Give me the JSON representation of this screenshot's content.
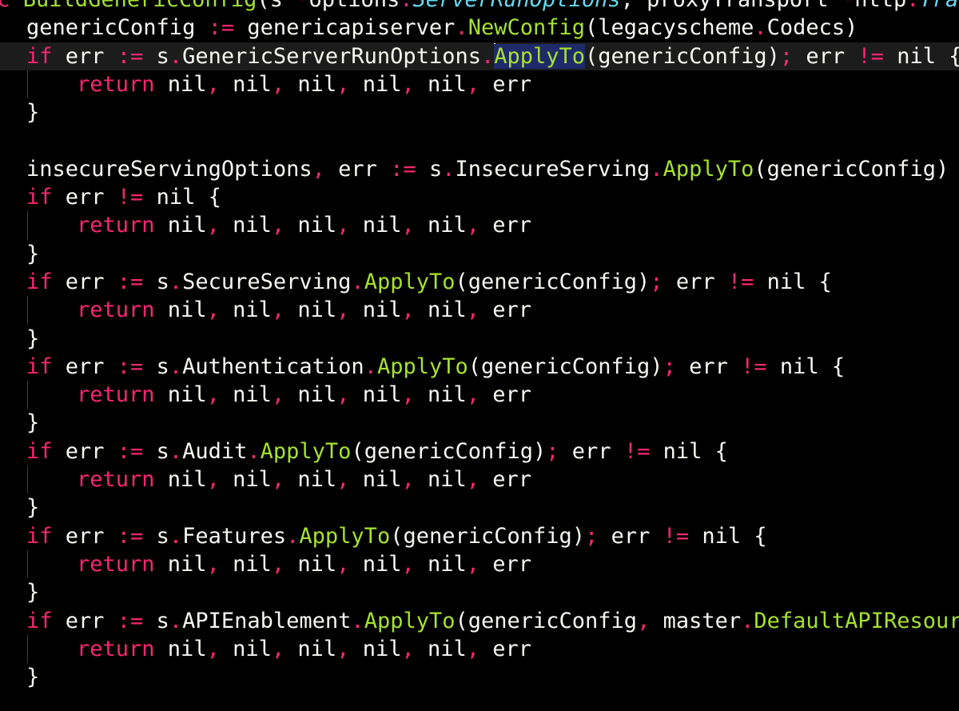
{
  "editor": {
    "language": "go",
    "theme_colors": {
      "background": "#000000",
      "text": "#f8f8f2",
      "keyword": "#f92672",
      "function": "#a6e22e",
      "type": "#66d9ef",
      "selection": "#1f2a6b",
      "current_line": "#1c1c1c",
      "indent_guide": "#3a3a3a"
    },
    "cursor": {
      "line": 2,
      "before_token": "ApplyTo"
    },
    "lines": [
      {
        "indent": 0,
        "guide": false,
        "current": false,
        "tokens": [
          {
            "t": "nc ",
            "c": "kw"
          },
          {
            "t": "BuildGenericConfig",
            "c": "fn"
          },
          {
            "t": "(s ",
            "c": "pl"
          },
          {
            "t": "*",
            "c": "op"
          },
          {
            "t": "options",
            "c": "pl"
          },
          {
            "t": ".",
            "c": "op"
          },
          {
            "t": "ServerRunOptions",
            "c": "ty"
          },
          {
            "t": ", proxyTransport ",
            "c": "pl"
          },
          {
            "t": "*",
            "c": "op"
          },
          {
            "t": "http",
            "c": "pl"
          },
          {
            "t": ".",
            "c": "op"
          },
          {
            "t": "Tran",
            "c": "ty"
          }
        ]
      },
      {
        "indent": 1,
        "guide": false,
        "current": false,
        "tokens": [
          {
            "t": "genericConfig ",
            "c": "pl"
          },
          {
            "t": ":=",
            "c": "op"
          },
          {
            "t": " genericapiserver",
            "c": "pl"
          },
          {
            "t": ".",
            "c": "op"
          },
          {
            "t": "NewConfig",
            "c": "fn"
          },
          {
            "t": "(legacyscheme",
            "c": "pl"
          },
          {
            "t": ".",
            "c": "op"
          },
          {
            "t": "Codecs)",
            "c": "pl"
          }
        ]
      },
      {
        "indent": 1,
        "guide": false,
        "current": true,
        "tokens": [
          {
            "t": "if",
            "c": "kw"
          },
          {
            "t": " err ",
            "c": "pl"
          },
          {
            "t": ":=",
            "c": "op"
          },
          {
            "t": " s",
            "c": "pl"
          },
          {
            "t": ".",
            "c": "op"
          },
          {
            "t": "GenericServerRunOptions",
            "c": "pl"
          },
          {
            "t": ".",
            "c": "op"
          },
          {
            "t": "ApplyTo",
            "c": "sel"
          },
          {
            "t": "(genericConfig)",
            "c": "pl"
          },
          {
            "t": ";",
            "c": "op"
          },
          {
            "t": " err ",
            "c": "pl"
          },
          {
            "t": "!=",
            "c": "op"
          },
          {
            "t": " nil {",
            "c": "pl"
          }
        ]
      },
      {
        "indent": 2,
        "guide": true,
        "current": false,
        "tokens": [
          {
            "t": "return",
            "c": "kw"
          },
          {
            "t": " nil",
            "c": "pl"
          },
          {
            "t": ",",
            "c": "op"
          },
          {
            "t": " nil",
            "c": "pl"
          },
          {
            "t": ",",
            "c": "op"
          },
          {
            "t": " nil",
            "c": "pl"
          },
          {
            "t": ",",
            "c": "op"
          },
          {
            "t": " nil",
            "c": "pl"
          },
          {
            "t": ",",
            "c": "op"
          },
          {
            "t": " nil",
            "c": "pl"
          },
          {
            "t": ",",
            "c": "op"
          },
          {
            "t": " err",
            "c": "pl"
          }
        ]
      },
      {
        "indent": 1,
        "guide": false,
        "current": false,
        "tokens": [
          {
            "t": "}",
            "c": "pl"
          }
        ]
      },
      {
        "indent": 1,
        "guide": false,
        "current": false,
        "tokens": []
      },
      {
        "indent": 1,
        "guide": false,
        "current": false,
        "tokens": [
          {
            "t": "insecureServingOptions",
            "c": "pl"
          },
          {
            "t": ",",
            "c": "op"
          },
          {
            "t": " err ",
            "c": "pl"
          },
          {
            "t": ":=",
            "c": "op"
          },
          {
            "t": " s",
            "c": "pl"
          },
          {
            "t": ".",
            "c": "op"
          },
          {
            "t": "InsecureServing",
            "c": "pl"
          },
          {
            "t": ".",
            "c": "op"
          },
          {
            "t": "ApplyTo",
            "c": "fn"
          },
          {
            "t": "(genericConfig)",
            "c": "pl"
          }
        ]
      },
      {
        "indent": 1,
        "guide": false,
        "current": false,
        "tokens": [
          {
            "t": "if",
            "c": "kw"
          },
          {
            "t": " err ",
            "c": "pl"
          },
          {
            "t": "!=",
            "c": "op"
          },
          {
            "t": " nil {",
            "c": "pl"
          }
        ]
      },
      {
        "indent": 2,
        "guide": true,
        "current": false,
        "tokens": [
          {
            "t": "return",
            "c": "kw"
          },
          {
            "t": " nil",
            "c": "pl"
          },
          {
            "t": ",",
            "c": "op"
          },
          {
            "t": " nil",
            "c": "pl"
          },
          {
            "t": ",",
            "c": "op"
          },
          {
            "t": " nil",
            "c": "pl"
          },
          {
            "t": ",",
            "c": "op"
          },
          {
            "t": " nil",
            "c": "pl"
          },
          {
            "t": ",",
            "c": "op"
          },
          {
            "t": " nil",
            "c": "pl"
          },
          {
            "t": ",",
            "c": "op"
          },
          {
            "t": " err",
            "c": "pl"
          }
        ]
      },
      {
        "indent": 1,
        "guide": false,
        "current": false,
        "tokens": [
          {
            "t": "}",
            "c": "pl"
          }
        ]
      },
      {
        "indent": 1,
        "guide": false,
        "current": false,
        "tokens": [
          {
            "t": "if",
            "c": "kw"
          },
          {
            "t": " err ",
            "c": "pl"
          },
          {
            "t": ":=",
            "c": "op"
          },
          {
            "t": " s",
            "c": "pl"
          },
          {
            "t": ".",
            "c": "op"
          },
          {
            "t": "SecureServing",
            "c": "pl"
          },
          {
            "t": ".",
            "c": "op"
          },
          {
            "t": "ApplyTo",
            "c": "fn"
          },
          {
            "t": "(genericConfig)",
            "c": "pl"
          },
          {
            "t": ";",
            "c": "op"
          },
          {
            "t": " err ",
            "c": "pl"
          },
          {
            "t": "!=",
            "c": "op"
          },
          {
            "t": " nil {",
            "c": "pl"
          }
        ]
      },
      {
        "indent": 2,
        "guide": true,
        "current": false,
        "tokens": [
          {
            "t": "return",
            "c": "kw"
          },
          {
            "t": " nil",
            "c": "pl"
          },
          {
            "t": ",",
            "c": "op"
          },
          {
            "t": " nil",
            "c": "pl"
          },
          {
            "t": ",",
            "c": "op"
          },
          {
            "t": " nil",
            "c": "pl"
          },
          {
            "t": ",",
            "c": "op"
          },
          {
            "t": " nil",
            "c": "pl"
          },
          {
            "t": ",",
            "c": "op"
          },
          {
            "t": " nil",
            "c": "pl"
          },
          {
            "t": ",",
            "c": "op"
          },
          {
            "t": " err",
            "c": "pl"
          }
        ]
      },
      {
        "indent": 1,
        "guide": false,
        "current": false,
        "tokens": [
          {
            "t": "}",
            "c": "pl"
          }
        ]
      },
      {
        "indent": 1,
        "guide": false,
        "current": false,
        "tokens": [
          {
            "t": "if",
            "c": "kw"
          },
          {
            "t": " err ",
            "c": "pl"
          },
          {
            "t": ":=",
            "c": "op"
          },
          {
            "t": " s",
            "c": "pl"
          },
          {
            "t": ".",
            "c": "op"
          },
          {
            "t": "Authentication",
            "c": "pl"
          },
          {
            "t": ".",
            "c": "op"
          },
          {
            "t": "ApplyTo",
            "c": "fn"
          },
          {
            "t": "(genericConfig)",
            "c": "pl"
          },
          {
            "t": ";",
            "c": "op"
          },
          {
            "t": " err ",
            "c": "pl"
          },
          {
            "t": "!=",
            "c": "op"
          },
          {
            "t": " nil {",
            "c": "pl"
          }
        ]
      },
      {
        "indent": 2,
        "guide": true,
        "current": false,
        "tokens": [
          {
            "t": "return",
            "c": "kw"
          },
          {
            "t": " nil",
            "c": "pl"
          },
          {
            "t": ",",
            "c": "op"
          },
          {
            "t": " nil",
            "c": "pl"
          },
          {
            "t": ",",
            "c": "op"
          },
          {
            "t": " nil",
            "c": "pl"
          },
          {
            "t": ",",
            "c": "op"
          },
          {
            "t": " nil",
            "c": "pl"
          },
          {
            "t": ",",
            "c": "op"
          },
          {
            "t": " nil",
            "c": "pl"
          },
          {
            "t": ",",
            "c": "op"
          },
          {
            "t": " err",
            "c": "pl"
          }
        ]
      },
      {
        "indent": 1,
        "guide": false,
        "current": false,
        "tokens": [
          {
            "t": "}",
            "c": "pl"
          }
        ]
      },
      {
        "indent": 1,
        "guide": false,
        "current": false,
        "tokens": [
          {
            "t": "if",
            "c": "kw"
          },
          {
            "t": " err ",
            "c": "pl"
          },
          {
            "t": ":=",
            "c": "op"
          },
          {
            "t": " s",
            "c": "pl"
          },
          {
            "t": ".",
            "c": "op"
          },
          {
            "t": "Audit",
            "c": "pl"
          },
          {
            "t": ".",
            "c": "op"
          },
          {
            "t": "ApplyTo",
            "c": "fn"
          },
          {
            "t": "(genericConfig)",
            "c": "pl"
          },
          {
            "t": ";",
            "c": "op"
          },
          {
            "t": " err ",
            "c": "pl"
          },
          {
            "t": "!=",
            "c": "op"
          },
          {
            "t": " nil {",
            "c": "pl"
          }
        ]
      },
      {
        "indent": 2,
        "guide": true,
        "current": false,
        "tokens": [
          {
            "t": "return",
            "c": "kw"
          },
          {
            "t": " nil",
            "c": "pl"
          },
          {
            "t": ",",
            "c": "op"
          },
          {
            "t": " nil",
            "c": "pl"
          },
          {
            "t": ",",
            "c": "op"
          },
          {
            "t": " nil",
            "c": "pl"
          },
          {
            "t": ",",
            "c": "op"
          },
          {
            "t": " nil",
            "c": "pl"
          },
          {
            "t": ",",
            "c": "op"
          },
          {
            "t": " nil",
            "c": "pl"
          },
          {
            "t": ",",
            "c": "op"
          },
          {
            "t": " err",
            "c": "pl"
          }
        ]
      },
      {
        "indent": 1,
        "guide": false,
        "current": false,
        "tokens": [
          {
            "t": "}",
            "c": "pl"
          }
        ]
      },
      {
        "indent": 1,
        "guide": false,
        "current": false,
        "tokens": [
          {
            "t": "if",
            "c": "kw"
          },
          {
            "t": " err ",
            "c": "pl"
          },
          {
            "t": ":=",
            "c": "op"
          },
          {
            "t": " s",
            "c": "pl"
          },
          {
            "t": ".",
            "c": "op"
          },
          {
            "t": "Features",
            "c": "pl"
          },
          {
            "t": ".",
            "c": "op"
          },
          {
            "t": "ApplyTo",
            "c": "fn"
          },
          {
            "t": "(genericConfig)",
            "c": "pl"
          },
          {
            "t": ";",
            "c": "op"
          },
          {
            "t": " err ",
            "c": "pl"
          },
          {
            "t": "!=",
            "c": "op"
          },
          {
            "t": " nil {",
            "c": "pl"
          }
        ]
      },
      {
        "indent": 2,
        "guide": true,
        "current": false,
        "tokens": [
          {
            "t": "return",
            "c": "kw"
          },
          {
            "t": " nil",
            "c": "pl"
          },
          {
            "t": ",",
            "c": "op"
          },
          {
            "t": " nil",
            "c": "pl"
          },
          {
            "t": ",",
            "c": "op"
          },
          {
            "t": " nil",
            "c": "pl"
          },
          {
            "t": ",",
            "c": "op"
          },
          {
            "t": " nil",
            "c": "pl"
          },
          {
            "t": ",",
            "c": "op"
          },
          {
            "t": " nil",
            "c": "pl"
          },
          {
            "t": ",",
            "c": "op"
          },
          {
            "t": " err",
            "c": "pl"
          }
        ]
      },
      {
        "indent": 1,
        "guide": false,
        "current": false,
        "tokens": [
          {
            "t": "}",
            "c": "pl"
          }
        ]
      },
      {
        "indent": 1,
        "guide": false,
        "current": false,
        "tokens": [
          {
            "t": "if",
            "c": "kw"
          },
          {
            "t": " err ",
            "c": "pl"
          },
          {
            "t": ":=",
            "c": "op"
          },
          {
            "t": " s",
            "c": "pl"
          },
          {
            "t": ".",
            "c": "op"
          },
          {
            "t": "APIEnablement",
            "c": "pl"
          },
          {
            "t": ".",
            "c": "op"
          },
          {
            "t": "ApplyTo",
            "c": "fn"
          },
          {
            "t": "(genericConfig",
            "c": "pl"
          },
          {
            "t": ",",
            "c": "op"
          },
          {
            "t": " master",
            "c": "pl"
          },
          {
            "t": ".",
            "c": "op"
          },
          {
            "t": "DefaultAPIResource",
            "c": "fn"
          }
        ]
      },
      {
        "indent": 2,
        "guide": true,
        "current": false,
        "tokens": [
          {
            "t": "return",
            "c": "kw"
          },
          {
            "t": " nil",
            "c": "pl"
          },
          {
            "t": ",",
            "c": "op"
          },
          {
            "t": " nil",
            "c": "pl"
          },
          {
            "t": ",",
            "c": "op"
          },
          {
            "t": " nil",
            "c": "pl"
          },
          {
            "t": ",",
            "c": "op"
          },
          {
            "t": " nil",
            "c": "pl"
          },
          {
            "t": ",",
            "c": "op"
          },
          {
            "t": " nil",
            "c": "pl"
          },
          {
            "t": ",",
            "c": "op"
          },
          {
            "t": " err",
            "c": "pl"
          }
        ]
      },
      {
        "indent": 1,
        "guide": false,
        "current": false,
        "tokens": [
          {
            "t": "}",
            "c": "pl"
          }
        ]
      }
    ]
  }
}
